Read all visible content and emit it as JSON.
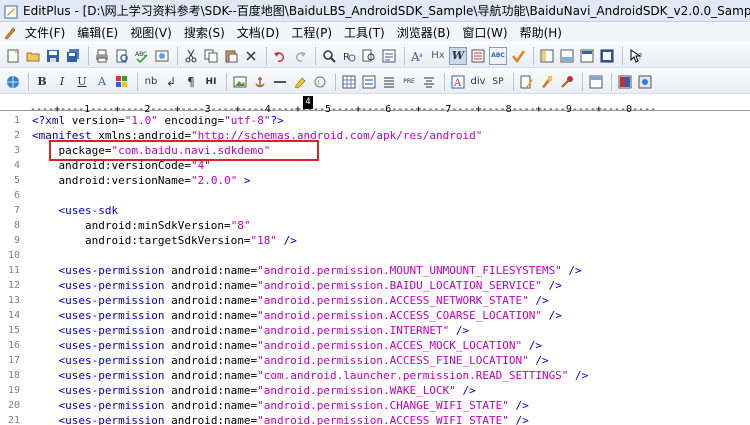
{
  "window": {
    "title": "EditPlus - [D:\\网上学习资料参考\\SDK--百度地图\\BaiduLBS_AndroidSDK_Sample\\导航功能\\BaiduNavi_AndroidSDK_v2.0.0_Sample\\Ba"
  },
  "menu": {
    "items": [
      "文件(F)",
      "编辑(E)",
      "视图(V)",
      "搜索(S)",
      "文档(D)",
      "工程(P)",
      "工具(T)",
      "浏览器(B)",
      "窗口(W)",
      "帮助(H)"
    ]
  },
  "toolbar2": {
    "bold": "B",
    "italic": "I",
    "underline": "U",
    "font_a": "A",
    "nbsp": "nb",
    "br": "↲",
    "para": "¶",
    "hi": "HI",
    "pre": "PRE",
    "div": "div",
    "sp": "SP"
  },
  "toolbar1": {
    "hx": "Hx",
    "w": "W",
    "abc": "ABC"
  },
  "ruler": {
    "text": "----+----1----+----2----+----3----+----4----+----5----+----6----+----7----+----8----+----9----+----0----",
    "cursor_col": "4"
  },
  "code_lines": [
    {
      "n": "1",
      "parts": [
        [
          "tag",
          "<?xml "
        ],
        [
          "attr",
          "version="
        ],
        [
          "val",
          "\"1.0\""
        ],
        [
          "attr",
          " encoding="
        ],
        [
          "val",
          "\"utf-8\""
        ],
        [
          "tag",
          "?>"
        ]
      ]
    },
    {
      "n": "2",
      "parts": [
        [
          "tag",
          "<manifest "
        ],
        [
          "attr",
          "xmlns:android="
        ],
        [
          "val",
          "\"http://schemas.android.com/apk/res/android\""
        ]
      ]
    },
    {
      "n": "3",
      "parts": [
        [
          "attr",
          "    package="
        ],
        [
          "val",
          "\"com.baidu.navi.sdkdemo\""
        ]
      ]
    },
    {
      "n": "4",
      "parts": [
        [
          "attr",
          "    android:versionCode="
        ],
        [
          "val",
          "\"4\""
        ]
      ]
    },
    {
      "n": "5",
      "parts": [
        [
          "attr",
          "    android:versionName="
        ],
        [
          "val",
          "\"2.0.0\""
        ],
        [
          "tag",
          " >"
        ]
      ]
    },
    {
      "n": "6",
      "parts": []
    },
    {
      "n": "7",
      "parts": [
        [
          "tag",
          "    <uses-sdk"
        ]
      ]
    },
    {
      "n": "8",
      "parts": [
        [
          "attr",
          "        android:minSdkVersion="
        ],
        [
          "val",
          "\"8\""
        ]
      ]
    },
    {
      "n": "9",
      "parts": [
        [
          "attr",
          "        android:targetSdkVersion="
        ],
        [
          "val",
          "\"18\""
        ],
        [
          "tag",
          " />"
        ]
      ]
    },
    {
      "n": "10",
      "parts": []
    },
    {
      "n": "11",
      "parts": [
        [
          "tag",
          "    <uses-permission "
        ],
        [
          "attr",
          "android:name="
        ],
        [
          "val",
          "\"android.permission.MOUNT_UNMOUNT_FILESYSTEMS\""
        ],
        [
          "tag",
          " />"
        ]
      ]
    },
    {
      "n": "12",
      "parts": [
        [
          "tag",
          "    <uses-permission "
        ],
        [
          "attr",
          "android:name="
        ],
        [
          "val",
          "\"android.permission.BAIDU_LOCATION_SERVICE\""
        ],
        [
          "tag",
          " />"
        ]
      ]
    },
    {
      "n": "13",
      "parts": [
        [
          "tag",
          "    <uses-permission "
        ],
        [
          "attr",
          "android:name="
        ],
        [
          "val",
          "\"android.permission.ACCESS_NETWORK_STATE\""
        ],
        [
          "tag",
          " />"
        ]
      ]
    },
    {
      "n": "14",
      "parts": [
        [
          "tag",
          "    <uses-permission "
        ],
        [
          "attr",
          "android:name="
        ],
        [
          "val",
          "\"android.permission.ACCESS_COARSE_LOCATION\""
        ],
        [
          "tag",
          " />"
        ]
      ]
    },
    {
      "n": "15",
      "parts": [
        [
          "tag",
          "    <uses-permission "
        ],
        [
          "attr",
          "android:name="
        ],
        [
          "val",
          "\"android.permission.INTERNET\""
        ],
        [
          "tag",
          " />"
        ]
      ]
    },
    {
      "n": "16",
      "parts": [
        [
          "tag",
          "    <uses-permission "
        ],
        [
          "attr",
          "android:name="
        ],
        [
          "val",
          "\"android.permission.ACCES_MOCK_LOCATION\""
        ],
        [
          "tag",
          " />"
        ]
      ]
    },
    {
      "n": "17",
      "parts": [
        [
          "tag",
          "    <uses-permission "
        ],
        [
          "attr",
          "android:name="
        ],
        [
          "val",
          "\"android.permission.ACCESS_FINE_LOCATION\""
        ],
        [
          "tag",
          " />"
        ]
      ]
    },
    {
      "n": "18",
      "parts": [
        [
          "tag",
          "    <uses-permission "
        ],
        [
          "attr",
          "android:name="
        ],
        [
          "val",
          "\"com.android.launcher.permission.READ_SETTINGS\""
        ],
        [
          "tag",
          " />"
        ]
      ]
    },
    {
      "n": "19",
      "parts": [
        [
          "tag",
          "    <uses-permission "
        ],
        [
          "attr",
          "android:name="
        ],
        [
          "val",
          "\"android.permission.WAKE_LOCK\""
        ],
        [
          "tag",
          " />"
        ]
      ]
    },
    {
      "n": "20",
      "parts": [
        [
          "tag",
          "    <uses-permission "
        ],
        [
          "attr",
          "android:name="
        ],
        [
          "val",
          "\"android.permission.CHANGE_WIFI_STATE\""
        ],
        [
          "tag",
          " />"
        ]
      ]
    },
    {
      "n": "21",
      "parts": [
        [
          "tag",
          "    <uses-permission "
        ],
        [
          "attr",
          "android:name="
        ],
        [
          "val",
          "\"android.permission.ACCESS_WIFI_STATE\""
        ],
        [
          "tag",
          " />"
        ]
      ]
    }
  ],
  "colors": {
    "tag": "#0000c0",
    "value": "#c000c0",
    "highlight_box": "#e02020"
  }
}
